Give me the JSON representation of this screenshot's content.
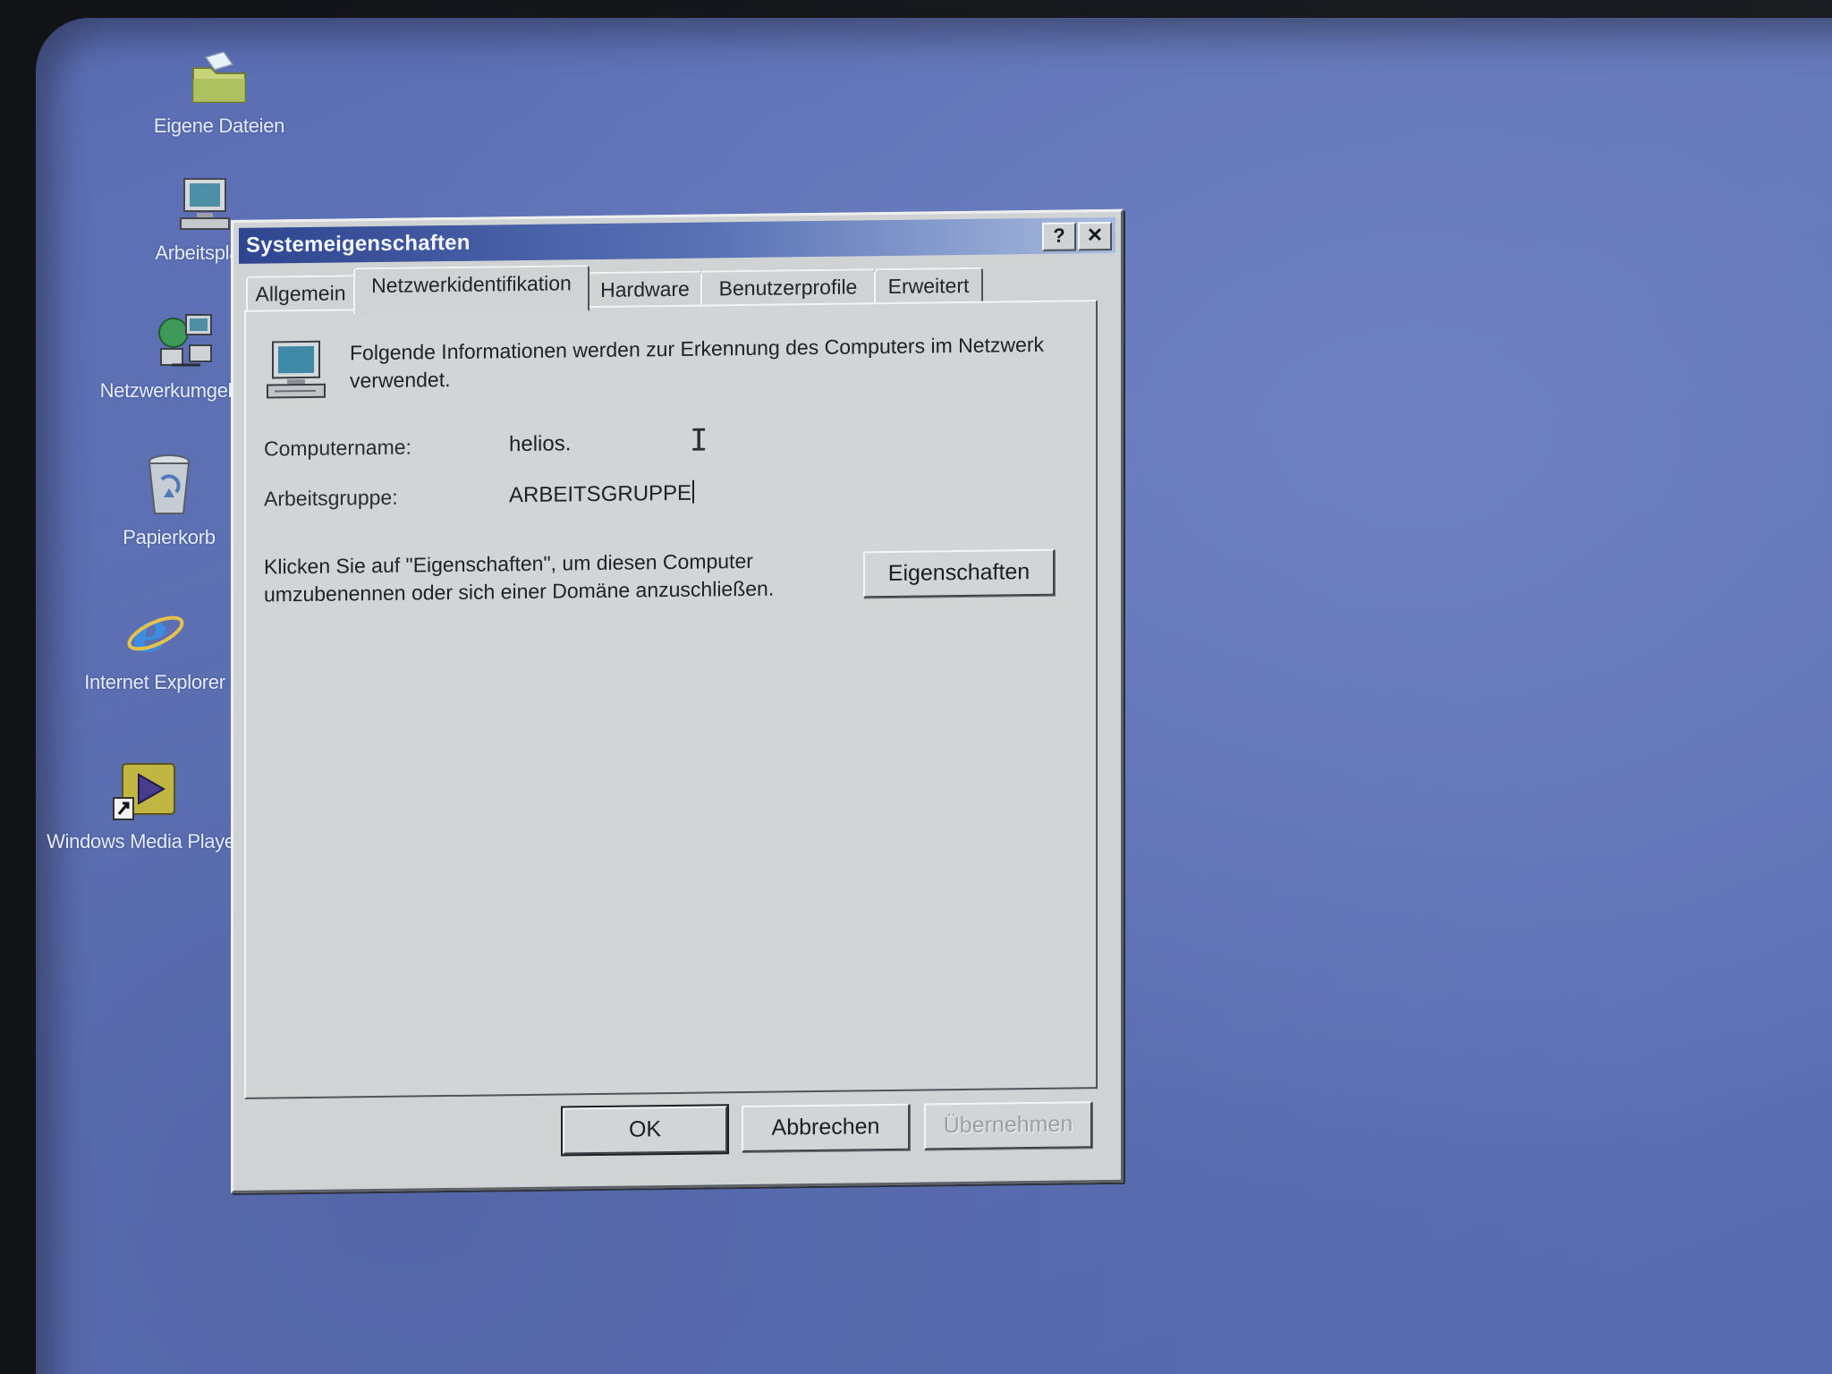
{
  "desktop": {
    "icons": [
      {
        "label": "Eigene Dateien",
        "icon": "folder-icon"
      },
      {
        "label": "Arbeitsplatz",
        "icon": "computer-icon"
      },
      {
        "label": "Netzwerkumgebung",
        "icon": "network-icon"
      },
      {
        "label": "Papierkorb",
        "icon": "recycle-bin-icon"
      },
      {
        "label": "Internet Explorer",
        "icon": "internet-explorer-icon"
      },
      {
        "label": "Windows Media Player",
        "icon": "media-player-icon"
      }
    ]
  },
  "dialog": {
    "title": "Systemeigenschaften",
    "help_button": "?",
    "close_button": "✕",
    "tabs": [
      {
        "label": "Allgemein",
        "active": false
      },
      {
        "label": "Netzwerkidentifikation",
        "active": true
      },
      {
        "label": "Hardware",
        "active": false
      },
      {
        "label": "Benutzerprofile",
        "active": false
      },
      {
        "label": "Erweitert",
        "active": false
      }
    ],
    "panel": {
      "info_text": "Folgende Informationen werden zur Erkennung des Computers im Netzwerk verwendet.",
      "computer_name_label": "Computername:",
      "computer_name_value": "helios.",
      "workgroup_label": "Arbeitsgruppe:",
      "workgroup_value": "ARBEITSGRUPPE",
      "hint_text": "Klicken Sie auf \"Eigenschaften\", um diesen Computer umzubenennen oder sich einer Domäne anzuschließen.",
      "properties_button": "Eigenschaften"
    },
    "buttons": {
      "ok": "OK",
      "cancel": "Abbrechen",
      "apply": "Übernehmen",
      "apply_enabled": false
    }
  },
  "colors": {
    "desktop": "#5a6db3",
    "titlebar_start": "#2e4590",
    "titlebar_end": "#a9bbe0",
    "dialog_face": "#cfd3d4"
  }
}
